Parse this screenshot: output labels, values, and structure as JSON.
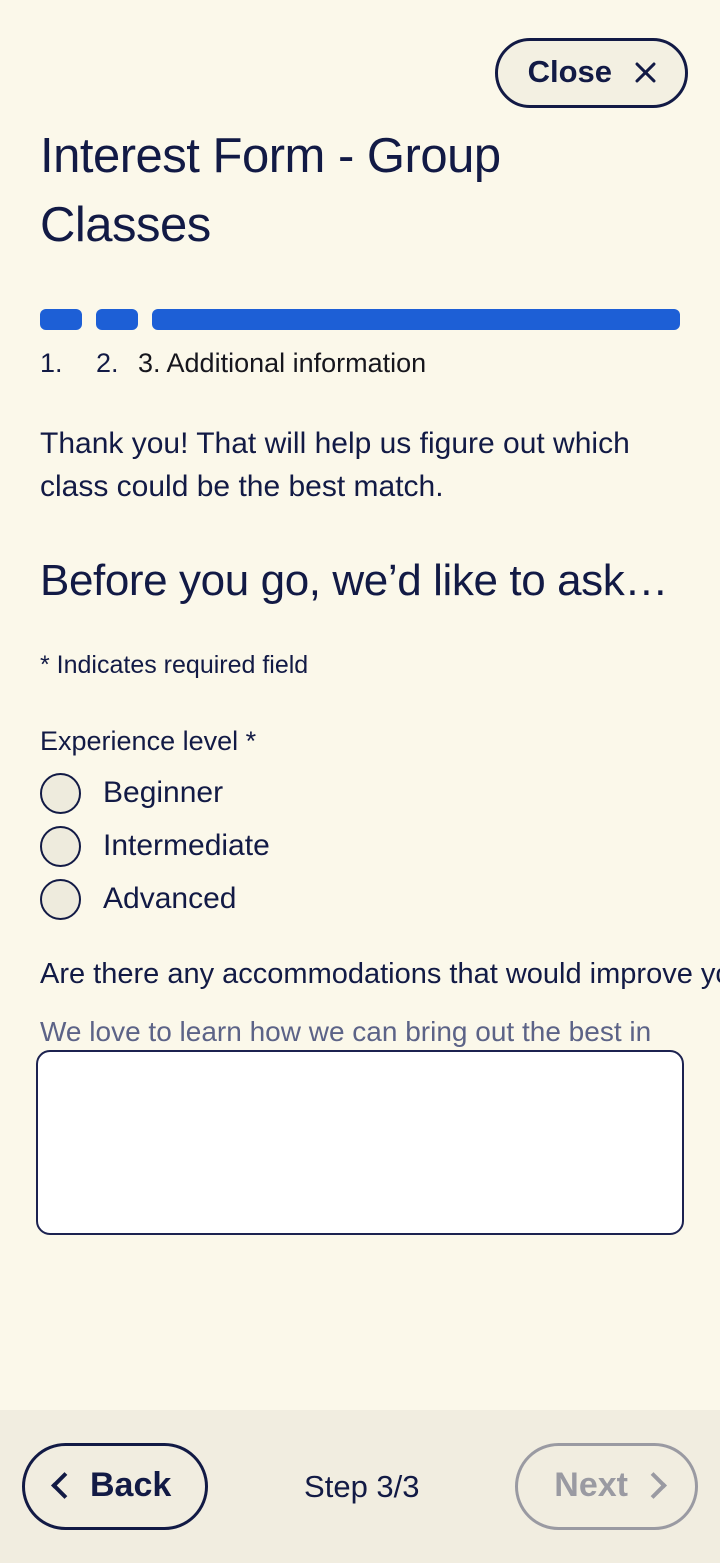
{
  "modal": {
    "close_label": "Close",
    "title": "Interest Form - Group Classes"
  },
  "progress": {
    "steps": [
      {
        "number": "1.",
        "label": "",
        "state": "complete"
      },
      {
        "number": "2.",
        "label": "",
        "state": "complete"
      },
      {
        "number": "3.",
        "label": "Additional information",
        "state": "current"
      }
    ],
    "current_label": "3. Additional information",
    "bar_color": "#1d5fd6"
  },
  "content": {
    "intro": "Thank you! That will help us figure out which class could be the best match.",
    "section_heading": "Before you go, we’d like to ask…",
    "required_note": "* Indicates required field"
  },
  "fields": {
    "experience": {
      "label": "Experience level *",
      "options": [
        {
          "label": "Beginner",
          "selected": false
        },
        {
          "label": "Intermediate",
          "selected": false
        },
        {
          "label": "Advanced",
          "selected": false
        }
      ]
    },
    "accommodations": {
      "question": "Are there any accommodations that would improve your",
      "help": "We love to learn how we can bring out the best in every participant.",
      "value": ""
    }
  },
  "footer": {
    "back_label": "Back",
    "next_label": "Next",
    "step_indicator": "Step 3/3",
    "next_disabled": true
  },
  "colors": {
    "page_background": "#fbf8ea",
    "footer_background": "#f1ede0",
    "ink": "#121a45",
    "accent": "#1d5fd6",
    "muted": "#5c6387",
    "disabled": "#9a9aa2"
  }
}
